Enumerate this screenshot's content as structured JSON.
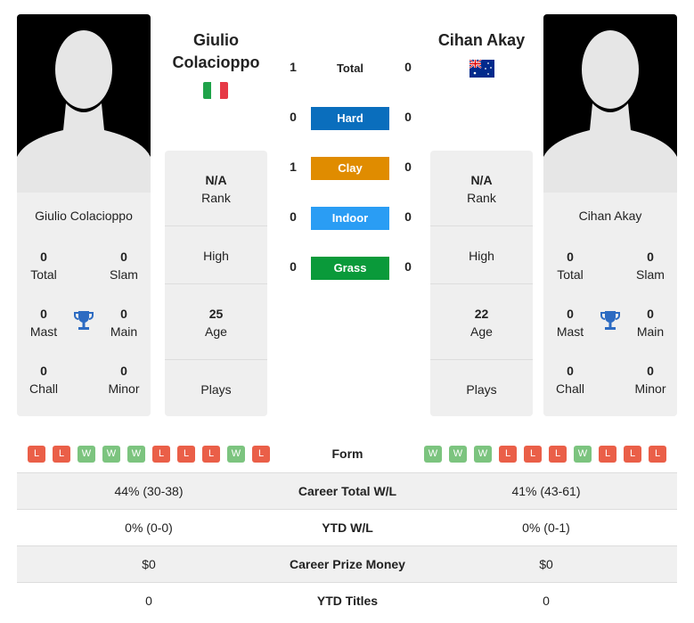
{
  "player1": {
    "name": "Giulio Colacioppo",
    "title_line1": "Giulio",
    "title_line2": "Colacioppo",
    "flag": "italy-flag",
    "total": "0",
    "slam": "0",
    "mast": "0",
    "main": "0",
    "chall": "0",
    "minor": "0",
    "rank": "N/A",
    "high": "",
    "age": "25",
    "plays": ""
  },
  "player2": {
    "name": "Cihan Akay",
    "title": "Cihan Akay",
    "flag": "australia-flag",
    "total": "0",
    "slam": "0",
    "mast": "0",
    "main": "0",
    "chall": "0",
    "minor": "0",
    "rank": "N/A",
    "high": "",
    "age": "22",
    "plays": ""
  },
  "labels": {
    "total": "Total",
    "slam": "Slam",
    "mast": "Mast",
    "main": "Main",
    "chall": "Chall",
    "minor": "Minor",
    "rank": "Rank",
    "high": "High",
    "age": "Age",
    "plays": "Plays"
  },
  "h2h": [
    {
      "label": "Total",
      "p1": "1",
      "p2": "0",
      "color": ""
    },
    {
      "label": "Hard",
      "p1": "0",
      "p2": "0",
      "color": "#0a6ebd"
    },
    {
      "label": "Clay",
      "p1": "1",
      "p2": "0",
      "color": "#e08c00"
    },
    {
      "label": "Indoor",
      "p1": "0",
      "p2": "0",
      "color": "#2a9df4"
    },
    {
      "label": "Grass",
      "p1": "0",
      "p2": "0",
      "color": "#0a9a3a"
    }
  ],
  "form": {
    "label": "Form",
    "p1": [
      "L",
      "L",
      "W",
      "W",
      "W",
      "L",
      "L",
      "L",
      "W",
      "L"
    ],
    "p2": [
      "W",
      "W",
      "W",
      "L",
      "L",
      "L",
      "W",
      "L",
      "L",
      "L"
    ],
    "colors": {
      "W": "#7cc47f",
      "L": "#ea5f48"
    }
  },
  "rows": [
    {
      "label": "Career Total W/L",
      "p1": "44% (30-38)",
      "p2": "41% (43-61)"
    },
    {
      "label": "YTD W/L",
      "p1": "0% (0-0)",
      "p2": "0% (0-1)"
    },
    {
      "label": "Career Prize Money",
      "p1": "$0",
      "p2": "$0"
    },
    {
      "label": "YTD Titles",
      "p1": "0",
      "p2": "0"
    }
  ]
}
